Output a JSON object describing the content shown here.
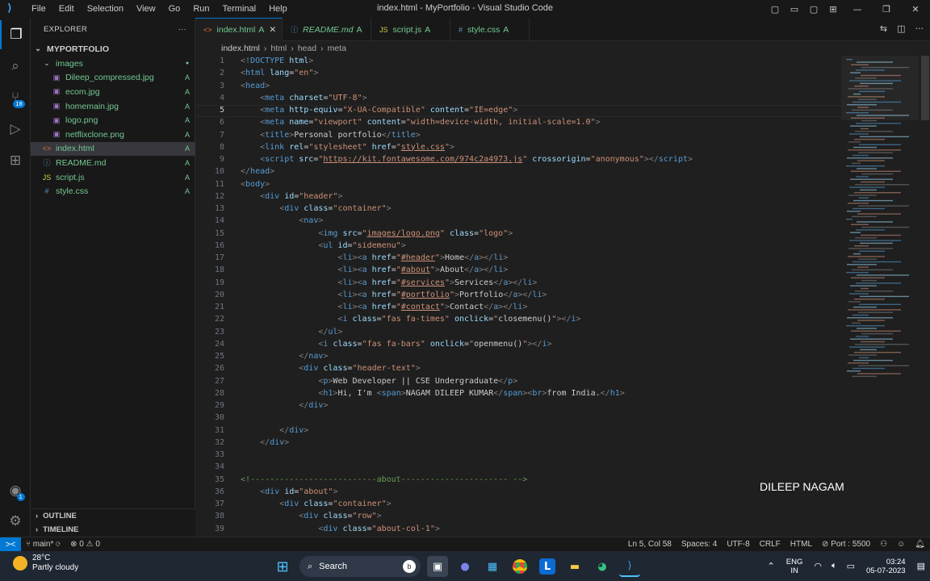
{
  "titlebar": {
    "menu": [
      "File",
      "Edit",
      "Selection",
      "View",
      "Go",
      "Run",
      "Terminal",
      "Help"
    ],
    "title": "index.html - MyPortfolio - Visual Studio Code"
  },
  "activity": {
    "items": [
      "files-icon",
      "search-icon",
      "source-control-icon",
      "run-debug-icon",
      "extensions-icon"
    ],
    "scm_badge": "18",
    "account_badge": "1"
  },
  "explorer": {
    "header": "EXPLORER",
    "more": "···",
    "root": "MYPORTFOLIO",
    "items": [
      {
        "name": "images",
        "kind": "folder",
        "status": "●",
        "indent": 1
      },
      {
        "name": "Dileep_compressed.jpg",
        "kind": "image",
        "status": "A",
        "indent": 2
      },
      {
        "name": "ecom.jpg",
        "kind": "image",
        "status": "A",
        "indent": 2
      },
      {
        "name": "homemain.jpg",
        "kind": "image",
        "status": "A",
        "indent": 2
      },
      {
        "name": "logo.png",
        "kind": "image",
        "status": "A",
        "indent": 2
      },
      {
        "name": "netflixclone.png",
        "kind": "image",
        "status": "A",
        "indent": 2
      },
      {
        "name": "index.html",
        "kind": "html",
        "status": "A",
        "indent": 1,
        "selected": true
      },
      {
        "name": "README.md",
        "kind": "md",
        "status": "A",
        "indent": 1
      },
      {
        "name": "script.js",
        "kind": "js",
        "status": "A",
        "indent": 1
      },
      {
        "name": "style.css",
        "kind": "css",
        "status": "A",
        "indent": 1
      }
    ],
    "outline": "OUTLINE",
    "timeline": "TIMELINE"
  },
  "tabs": [
    {
      "name": "index.html",
      "status": "A",
      "icon": "<>",
      "active": true,
      "close": "✕"
    },
    {
      "name": "README.md",
      "status": "A",
      "icon": "ⓘ",
      "italic": true
    },
    {
      "name": "script.js",
      "status": "A",
      "icon": "JS"
    },
    {
      "name": "style.css",
      "status": "A",
      "icon": "#"
    }
  ],
  "breadcrumb": [
    "index.html",
    "›",
    "html",
    "›",
    "head",
    "›",
    "meta"
  ],
  "code_lines": [
    [
      [
        "t",
        "<!"
      ],
      [
        "tg",
        "DOCTYPE"
      ],
      [
        "t",
        " "
      ],
      [
        "at",
        "html"
      ],
      [
        "t",
        ">"
      ]
    ],
    [
      [
        "t",
        "<"
      ],
      [
        "tg",
        "html"
      ],
      [
        "at",
        " lang"
      ],
      [
        "p",
        "="
      ],
      [
        "sv",
        "\"en\""
      ],
      [
        "t",
        ">"
      ]
    ],
    [
      [
        "t",
        "<"
      ],
      [
        "tg",
        "head"
      ],
      [
        "t",
        ">"
      ]
    ],
    [
      [
        "p",
        "    "
      ],
      [
        "t",
        "<"
      ],
      [
        "tg",
        "meta"
      ],
      [
        "at",
        " charset"
      ],
      [
        "p",
        "="
      ],
      [
        "sv",
        "\"UTF-8\""
      ],
      [
        "t",
        ">"
      ]
    ],
    [
      [
        "p",
        "    "
      ],
      [
        "t",
        "<"
      ],
      [
        "tg",
        "meta"
      ],
      [
        "at",
        " http-equiv"
      ],
      [
        "p",
        "="
      ],
      [
        "sv",
        "\"X-UA-Compatible\""
      ],
      [
        "at",
        " content"
      ],
      [
        "p",
        "="
      ],
      [
        "sv",
        "\"IE=edge\""
      ],
      [
        "t",
        ">"
      ]
    ],
    [
      [
        "p",
        "    "
      ],
      [
        "t",
        "<"
      ],
      [
        "tg",
        "meta"
      ],
      [
        "at",
        " name"
      ],
      [
        "p",
        "="
      ],
      [
        "sv",
        "\"viewport\""
      ],
      [
        "at",
        " content"
      ],
      [
        "p",
        "="
      ],
      [
        "sv",
        "\"width=device-width, initial-scale=1.0\""
      ],
      [
        "t",
        ">"
      ]
    ],
    [
      [
        "p",
        "    "
      ],
      [
        "t",
        "<"
      ],
      [
        "tg",
        "title"
      ],
      [
        "t",
        ">"
      ],
      [
        "p",
        "Personal portfolio"
      ],
      [
        "t",
        "</"
      ],
      [
        "tg",
        "title"
      ],
      [
        "t",
        ">"
      ]
    ],
    [
      [
        "p",
        "    "
      ],
      [
        "t",
        "<"
      ],
      [
        "tg",
        "link"
      ],
      [
        "at",
        " rel"
      ],
      [
        "p",
        "="
      ],
      [
        "sv",
        "\"stylesheet\""
      ],
      [
        "at",
        " href"
      ],
      [
        "p",
        "="
      ],
      [
        "sv",
        "\""
      ],
      [
        "u",
        "style.css"
      ],
      [
        "sv",
        "\""
      ],
      [
        "t",
        ">"
      ]
    ],
    [
      [
        "p",
        "    "
      ],
      [
        "t",
        "<"
      ],
      [
        "tg",
        "script"
      ],
      [
        "at",
        " src"
      ],
      [
        "p",
        "="
      ],
      [
        "sv",
        "\""
      ],
      [
        "u",
        "https://kit.fontawesome.com/974c2a4973.js"
      ],
      [
        "sv",
        "\""
      ],
      [
        "at",
        " crossorigin"
      ],
      [
        "p",
        "="
      ],
      [
        "sv",
        "\"anonymous\""
      ],
      [
        "t",
        "></"
      ],
      [
        "tg",
        "script"
      ],
      [
        "t",
        ">"
      ]
    ],
    [
      [
        "t",
        "</"
      ],
      [
        "tg",
        "head"
      ],
      [
        "t",
        ">"
      ]
    ],
    [
      [
        "t",
        "<"
      ],
      [
        "tg",
        "body"
      ],
      [
        "t",
        ">"
      ]
    ],
    [
      [
        "p",
        "    "
      ],
      [
        "t",
        "<"
      ],
      [
        "tg",
        "div"
      ],
      [
        "at",
        " id"
      ],
      [
        "p",
        "="
      ],
      [
        "sv",
        "\"header\""
      ],
      [
        "t",
        ">"
      ]
    ],
    [
      [
        "p",
        "        "
      ],
      [
        "t",
        "<"
      ],
      [
        "tg",
        "div"
      ],
      [
        "at",
        " class"
      ],
      [
        "p",
        "="
      ],
      [
        "sv",
        "\"container\""
      ],
      [
        "t",
        ">"
      ]
    ],
    [
      [
        "p",
        "            "
      ],
      [
        "t",
        "<"
      ],
      [
        "tg",
        "nav"
      ],
      [
        "t",
        ">"
      ]
    ],
    [
      [
        "p",
        "                "
      ],
      [
        "t",
        "<"
      ],
      [
        "tg",
        "img"
      ],
      [
        "at",
        " src"
      ],
      [
        "p",
        "="
      ],
      [
        "sv",
        "\""
      ],
      [
        "u",
        "images/logo.png"
      ],
      [
        "sv",
        "\""
      ],
      [
        "at",
        " class"
      ],
      [
        "p",
        "="
      ],
      [
        "sv",
        "\"logo\""
      ],
      [
        "t",
        ">"
      ]
    ],
    [
      [
        "p",
        "                "
      ],
      [
        "t",
        "<"
      ],
      [
        "tg",
        "ul"
      ],
      [
        "at",
        " id"
      ],
      [
        "p",
        "="
      ],
      [
        "sv",
        "\"sidemenu\""
      ],
      [
        "t",
        ">"
      ]
    ],
    [
      [
        "p",
        "                    "
      ],
      [
        "t",
        "<"
      ],
      [
        "tg",
        "li"
      ],
      [
        "t",
        "><"
      ],
      [
        "tg",
        "a"
      ],
      [
        "at",
        " href"
      ],
      [
        "p",
        "="
      ],
      [
        "sv",
        "\""
      ],
      [
        "u",
        "#header"
      ],
      [
        "sv",
        "\""
      ],
      [
        "t",
        ">"
      ],
      [
        "p",
        "Home"
      ],
      [
        "t",
        "</"
      ],
      [
        "tg",
        "a"
      ],
      [
        "t",
        "></"
      ],
      [
        "tg",
        "li"
      ],
      [
        "t",
        ">"
      ]
    ],
    [
      [
        "p",
        "                    "
      ],
      [
        "t",
        "<"
      ],
      [
        "tg",
        "li"
      ],
      [
        "t",
        "><"
      ],
      [
        "tg",
        "a"
      ],
      [
        "at",
        " href"
      ],
      [
        "p",
        "="
      ],
      [
        "sv",
        "\""
      ],
      [
        "u",
        "#about"
      ],
      [
        "sv",
        "\""
      ],
      [
        "t",
        ">"
      ],
      [
        "p",
        "About"
      ],
      [
        "t",
        "</"
      ],
      [
        "tg",
        "a"
      ],
      [
        "t",
        "></"
      ],
      [
        "tg",
        "li"
      ],
      [
        "t",
        ">"
      ]
    ],
    [
      [
        "p",
        "                    "
      ],
      [
        "t",
        "<"
      ],
      [
        "tg",
        "li"
      ],
      [
        "t",
        "><"
      ],
      [
        "tg",
        "a"
      ],
      [
        "at",
        " href"
      ],
      [
        "p",
        "="
      ],
      [
        "sv",
        "\""
      ],
      [
        "u",
        "#services"
      ],
      [
        "sv",
        "\""
      ],
      [
        "t",
        ">"
      ],
      [
        "p",
        "Services"
      ],
      [
        "t",
        "</"
      ],
      [
        "tg",
        "a"
      ],
      [
        "t",
        "></"
      ],
      [
        "tg",
        "li"
      ],
      [
        "t",
        ">"
      ]
    ],
    [
      [
        "p",
        "                    "
      ],
      [
        "t",
        "<"
      ],
      [
        "tg",
        "li"
      ],
      [
        "t",
        "><"
      ],
      [
        "tg",
        "a"
      ],
      [
        "at",
        " href"
      ],
      [
        "p",
        "="
      ],
      [
        "sv",
        "\""
      ],
      [
        "u",
        "#portfolio"
      ],
      [
        "sv",
        "\""
      ],
      [
        "t",
        ">"
      ],
      [
        "p",
        "Portfolio"
      ],
      [
        "t",
        "</"
      ],
      [
        "tg",
        "a"
      ],
      [
        "t",
        "></"
      ],
      [
        "tg",
        "li"
      ],
      [
        "t",
        ">"
      ]
    ],
    [
      [
        "p",
        "                    "
      ],
      [
        "t",
        "<"
      ],
      [
        "tg",
        "li"
      ],
      [
        "t",
        "><"
      ],
      [
        "tg",
        "a"
      ],
      [
        "at",
        " href"
      ],
      [
        "p",
        "="
      ],
      [
        "sv",
        "\""
      ],
      [
        "u",
        "#contact"
      ],
      [
        "sv",
        "\""
      ],
      [
        "t",
        ">"
      ],
      [
        "p",
        "Contact"
      ],
      [
        "t",
        "</"
      ],
      [
        "tg",
        "a"
      ],
      [
        "t",
        "></"
      ],
      [
        "tg",
        "li"
      ],
      [
        "t",
        ">"
      ]
    ],
    [
      [
        "p",
        "                    "
      ],
      [
        "t",
        "<"
      ],
      [
        "tg",
        "i"
      ],
      [
        "at",
        " class"
      ],
      [
        "p",
        "="
      ],
      [
        "sv",
        "\"fas fa-times\""
      ],
      [
        "at",
        " onclick"
      ],
      [
        "p",
        "="
      ],
      [
        "sv",
        "\""
      ],
      [
        "p",
        "closemenu()"
      ],
      [
        "sv",
        "\""
      ],
      [
        "t",
        "></"
      ],
      [
        "tg",
        "i"
      ],
      [
        "t",
        ">"
      ]
    ],
    [
      [
        "p",
        "                "
      ],
      [
        "t",
        "</"
      ],
      [
        "tg",
        "ul"
      ],
      [
        "t",
        ">"
      ]
    ],
    [
      [
        "p",
        "                "
      ],
      [
        "t",
        "<"
      ],
      [
        "tg",
        "i"
      ],
      [
        "at",
        " class"
      ],
      [
        "p",
        "="
      ],
      [
        "sv",
        "\"fas fa-bars\""
      ],
      [
        "at",
        " onclick"
      ],
      [
        "p",
        "="
      ],
      [
        "sv",
        "\""
      ],
      [
        "p",
        "openmenu()"
      ],
      [
        "sv",
        "\""
      ],
      [
        "t",
        "></"
      ],
      [
        "tg",
        "i"
      ],
      [
        "t",
        ">"
      ]
    ],
    [
      [
        "p",
        "            "
      ],
      [
        "t",
        "</"
      ],
      [
        "tg",
        "nav"
      ],
      [
        "t",
        ">"
      ]
    ],
    [
      [
        "p",
        "            "
      ],
      [
        "t",
        "<"
      ],
      [
        "tg",
        "div"
      ],
      [
        "at",
        " class"
      ],
      [
        "p",
        "="
      ],
      [
        "sv",
        "\"header-text\""
      ],
      [
        "t",
        ">"
      ]
    ],
    [
      [
        "p",
        "                "
      ],
      [
        "t",
        "<"
      ],
      [
        "tg",
        "p"
      ],
      [
        "t",
        ">"
      ],
      [
        "p",
        "Web Developer || CSE Undergraduate"
      ],
      [
        "t",
        "</"
      ],
      [
        "tg",
        "p"
      ],
      [
        "t",
        ">"
      ]
    ],
    [
      [
        "p",
        "                "
      ],
      [
        "t",
        "<"
      ],
      [
        "tg",
        "h1"
      ],
      [
        "t",
        ">"
      ],
      [
        "p",
        "Hi, I'm "
      ],
      [
        "t",
        "<"
      ],
      [
        "tg",
        "span"
      ],
      [
        "t",
        ">"
      ],
      [
        "p",
        "NAGAM DILEEP KUMAR"
      ],
      [
        "t",
        "</"
      ],
      [
        "tg",
        "span"
      ],
      [
        "t",
        "><"
      ],
      [
        "tg",
        "br"
      ],
      [
        "t",
        ">"
      ],
      [
        "p",
        "from India."
      ],
      [
        "t",
        "</"
      ],
      [
        "tg",
        "h1"
      ],
      [
        "t",
        ">"
      ]
    ],
    [
      [
        "p",
        "            "
      ],
      [
        "t",
        "</"
      ],
      [
        "tg",
        "div"
      ],
      [
        "t",
        ">"
      ]
    ],
    [],
    [
      [
        "p",
        "        "
      ],
      [
        "t",
        "</"
      ],
      [
        "tg",
        "div"
      ],
      [
        "t",
        ">"
      ]
    ],
    [
      [
        "p",
        "    "
      ],
      [
        "t",
        "</"
      ],
      [
        "tg",
        "div"
      ],
      [
        "t",
        ">"
      ]
    ],
    [],
    [],
    [
      [
        "cm",
        "<!--------------------------about---------------------- -->"
      ]
    ],
    [
      [
        "p",
        "    "
      ],
      [
        "t",
        "<"
      ],
      [
        "tg",
        "div"
      ],
      [
        "at",
        " id"
      ],
      [
        "p",
        "="
      ],
      [
        "sv",
        "\"about\""
      ],
      [
        "t",
        ">"
      ]
    ],
    [
      [
        "p",
        "        "
      ],
      [
        "t",
        "<"
      ],
      [
        "tg",
        "div"
      ],
      [
        "at",
        " class"
      ],
      [
        "p",
        "="
      ],
      [
        "sv",
        "\"container\""
      ],
      [
        "t",
        ">"
      ]
    ],
    [
      [
        "p",
        "            "
      ],
      [
        "t",
        "<"
      ],
      [
        "tg",
        "div"
      ],
      [
        "at",
        " class"
      ],
      [
        "p",
        "="
      ],
      [
        "sv",
        "\"row\""
      ],
      [
        "t",
        ">"
      ]
    ],
    [
      [
        "p",
        "                "
      ],
      [
        "t",
        "<"
      ],
      [
        "tg",
        "div"
      ],
      [
        "at",
        " class"
      ],
      [
        "p",
        "="
      ],
      [
        "sv",
        "\"about-col-1\""
      ],
      [
        "t",
        ">"
      ]
    ]
  ],
  "current_line": 5,
  "watermark": "DILEEP NAGAM",
  "statusbar": {
    "remote_icon": "><",
    "branch": "main*",
    "sync": "⟳",
    "errors": "⊗ 0",
    "warnings": "⚠ 0",
    "position": "Ln 5, Col 58",
    "spaces": "Spaces: 4",
    "encoding": "UTF-8",
    "eol": "CRLF",
    "language": "HTML",
    "port": "⊘ Port : 5500"
  },
  "taskbar": {
    "temp": "28°C",
    "weather": "Partly cloudy",
    "search": "Search",
    "lang1": "ENG",
    "lang2": "IN",
    "time": "03:24",
    "date": "05-07-2023"
  }
}
